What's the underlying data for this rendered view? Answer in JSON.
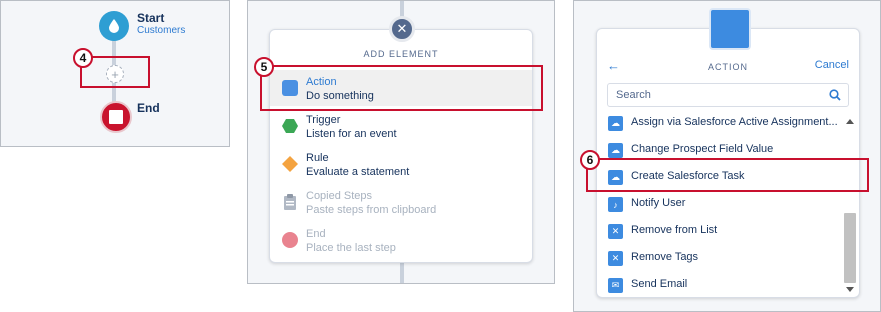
{
  "panel1": {
    "start_title": "Start",
    "start_sub": "Customers",
    "add_symbol": "+",
    "end_title": "End",
    "badge": "4"
  },
  "panel2": {
    "heading": "ADD ELEMENT",
    "close_symbol": "✕",
    "badge": "5",
    "items": [
      {
        "title": "Action",
        "desc": "Do something",
        "icon": "action-square-icon",
        "color": "#4a90e2"
      },
      {
        "title": "Trigger",
        "desc": "Listen for an event",
        "icon": "trigger-hexagon-icon",
        "color": "#3ba755"
      },
      {
        "title": "Rule",
        "desc": "Evaluate a statement",
        "icon": "rule-diamond-icon",
        "color": "#f4a340"
      },
      {
        "title": "Copied Steps",
        "desc": "Paste steps from clipboard",
        "icon": "clipboard-icon",
        "color": "#b0b8c4"
      },
      {
        "title": "End",
        "desc": "Place the last step",
        "icon": "end-circle-icon",
        "color": "#e9838f"
      }
    ]
  },
  "panel3": {
    "heading": "ACTION",
    "back_symbol": "←",
    "cancel": "Cancel",
    "search_placeholder": "Search",
    "badge": "6",
    "items": [
      {
        "label": "Assign via Salesforce Active Assignment...",
        "icon": "salesforce-cloud-icon"
      },
      {
        "label": "Change Prospect Field Value",
        "icon": "salesforce-cloud-icon"
      },
      {
        "label": "Create Salesforce Task",
        "icon": "salesforce-cloud-icon"
      },
      {
        "label": "Notify User",
        "icon": "bell-icon"
      },
      {
        "label": "Remove from List",
        "icon": "x-icon"
      },
      {
        "label": "Remove Tags",
        "icon": "x-icon"
      },
      {
        "label": "Send Email",
        "icon": "email-icon"
      }
    ]
  },
  "colors": {
    "accent_blue": "#2e7bd1",
    "callout_red": "#c8102e",
    "start_blue": "#2e9ed3",
    "end_red": "#c9132d"
  }
}
